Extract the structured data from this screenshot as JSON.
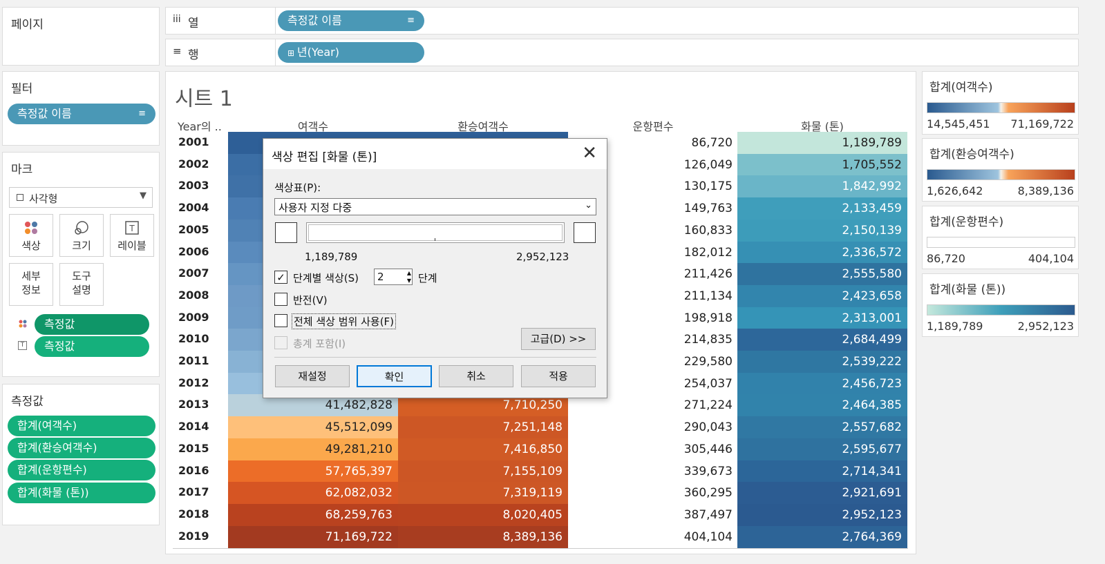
{
  "left_panels": {
    "pages": {
      "title": "페이지"
    },
    "filters": {
      "title": "필터",
      "pill": "측정값 이름"
    },
    "marks": {
      "title": "마크",
      "mark_type": "사각형",
      "buttons": {
        "color": "색상",
        "size": "크기",
        "label": "레이블",
        "detail": "세부\n정보",
        "detail_1": "세부",
        "detail_2": "정보",
        "tooltip_1": "도구",
        "tooltip_2": "설명"
      },
      "fields": [
        "측정값",
        "측정값"
      ]
    },
    "measures": {
      "title": "측정값",
      "pills": [
        "합계(여객수)",
        "합계(환승여객수)",
        "합계(운항편수)",
        "합계(화물 (톤))"
      ]
    }
  },
  "shelves": {
    "columns": {
      "label": "열",
      "pill": "측정값 이름"
    },
    "rows": {
      "label": "행",
      "pill": "년(Year)"
    }
  },
  "sheet": {
    "title": "시트 1",
    "headers": {
      "year": "Year의 ..",
      "passengers": "여객수",
      "transfer": "환승여객수",
      "flights": "운항편수",
      "cargo": "화물 (톤)"
    }
  },
  "table": {
    "years": [
      "2001",
      "2002",
      "2003",
      "2004",
      "2005",
      "2006",
      "2007",
      "2008",
      "2009",
      "2010",
      "2011",
      "2012",
      "2013",
      "2014",
      "2015",
      "2016",
      "2017",
      "2018",
      "2019"
    ],
    "passengers_visible": {
      "2013": "41,482,828",
      "2014": "45,512,099",
      "2015": "49,281,210",
      "2016": "57,765,397",
      "2017": "62,082,032",
      "2018": "68,259,763",
      "2019": "71,169,722"
    },
    "transfer_visible": {
      "2013": "7,710,250",
      "2014": "7,251,148",
      "2015": "7,416,850",
      "2016": "7,155,109",
      "2017": "7,319,119",
      "2018": "8,020,405",
      "2019": "8,389,136"
    },
    "flights": [
      "86,720",
      "126,049",
      "130,175",
      "149,763",
      "160,833",
      "182,012",
      "211,426",
      "211,134",
      "198,918",
      "214,835",
      "229,580",
      "254,037",
      "271,224",
      "290,043",
      "305,446",
      "339,673",
      "360,295",
      "387,497",
      "404,104"
    ],
    "cargo": [
      "1,189,789",
      "1,705,552",
      "1,842,992",
      "2,133,459",
      "2,150,139",
      "2,336,572",
      "2,555,580",
      "2,423,658",
      "2,313,001",
      "2,684,499",
      "2,539,222",
      "2,456,723",
      "2,464,385",
      "2,557,682",
      "2,595,677",
      "2,714,341",
      "2,921,691",
      "2,952,123",
      "2,764,369"
    ]
  },
  "legends": [
    {
      "title": "합계(여객수)",
      "min": "14,545,451",
      "max": "71,169,722"
    },
    {
      "title": "합계(환승여객수)",
      "min": "1,626,642",
      "max": "8,389,136"
    },
    {
      "title": "합계(운항편수)",
      "min": "86,720",
      "max": "404,104"
    },
    {
      "title": "합계(화물 (톤))",
      "min": "1,189,789",
      "max": "2,952,123"
    }
  ],
  "dialog": {
    "title": "색상 편집 [화물 (톤)]",
    "palette_label": "색상표(P):",
    "palette_value": "사용자 지정 다중",
    "range_min": "1,189,789",
    "range_max": "2,952,123",
    "stepped_label": "단계별 색상(S)",
    "stepped_checked": true,
    "steps_value": "2",
    "steps_unit": "단계",
    "reverse_label": "반전(V)",
    "full_range_label": "전체 색상 범위 사용(F)",
    "include_totals_label": "총계 포함(I)",
    "advanced_label": "고급(D) >>",
    "buttons": {
      "reset": "재설정",
      "ok": "확인",
      "cancel": "취소",
      "apply": "적용"
    }
  },
  "colors": {
    "pill_blue": "#4a98b6",
    "pill_green": "#15b07c",
    "highlight_blue": "#0078d7"
  }
}
